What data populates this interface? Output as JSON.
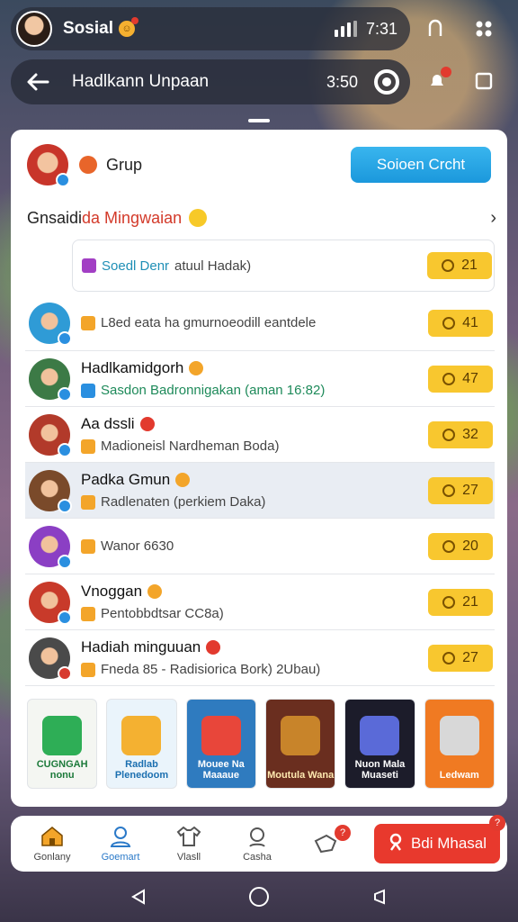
{
  "status_bar": {
    "title": "Sosial",
    "time": "7:31"
  },
  "header": {
    "title": "Hadlkann Unpaan",
    "count": "3:50"
  },
  "group": {
    "label": "Grup",
    "join_button": "Soioen Crcht"
  },
  "section": {
    "title_prefix": "Gnsaidi",
    "title_accent": "da Mingwaian"
  },
  "items": [
    {
      "name": "Soedl Denr",
      "sub": "atuul Hadak)",
      "pill": "21",
      "avatar_color": "#7b3fb8",
      "style": "boxed"
    },
    {
      "name": "",
      "sub": "L8ed eata ha gmurnoeodill eantdele",
      "pill": "41",
      "avatar_color": "#2f9bd6",
      "style": "normal"
    },
    {
      "name": "Hadlkamidgorh",
      "sub": "Sasdon Badronnigakan (aman 16:82)",
      "pill": "47",
      "avatar_color": "#3c7a46",
      "style": "normal",
      "sub_style": "green"
    },
    {
      "name": "Aa dssli",
      "sub": "Madioneisl Nardheman Boda)",
      "pill": "32",
      "avatar_color": "#b23a2a",
      "style": "normal"
    },
    {
      "name": "Padka Gmun",
      "sub": "Radlenaten (perkiem Daka)",
      "pill": "27",
      "avatar_color": "#7a4a2a",
      "style": "highlight"
    },
    {
      "name": "",
      "sub": "Wanor 6630",
      "pill": "20",
      "avatar_color": "#8b3fc4",
      "style": "normal"
    },
    {
      "name": "Vnoggan",
      "sub": "Pentobbdtsar CC8a)",
      "pill": "21",
      "avatar_color": "#c83a2a",
      "style": "normal"
    },
    {
      "name": "Hadiah minguuan",
      "sub": "Fneda 85 - Radisiorica Bork)  2Ubau)",
      "pill": "27",
      "avatar_color": "#4a4a4a",
      "style": "normal"
    }
  ],
  "tiles": [
    {
      "label": "CUGNGAH nonu",
      "bg": "#f4f6f2",
      "fg": "#1c7a3a",
      "art": "#2eae56"
    },
    {
      "label": "Radlab Plenedoom",
      "bg": "#eaf4fb",
      "fg": "#1b6fb0",
      "art": "#f4b131"
    },
    {
      "label": "Mouee Na Maaaue",
      "bg": "#2f7bbf",
      "fg": "#ffffff",
      "art": "#e8463a"
    },
    {
      "label": "Moutula Wana",
      "bg": "#6a2e1f",
      "fg": "#ffe9b0",
      "art": "#c8842a"
    },
    {
      "label": "Nuon Mala Muaseti",
      "bg": "#1c1c2a",
      "fg": "#ffffff",
      "art": "#5a6ad8"
    },
    {
      "label": "Ledwam",
      "bg": "#f07a22",
      "fg": "#ffffff",
      "art": "#d8d8d8"
    }
  ],
  "nav": {
    "items": [
      {
        "label": "Gonlany",
        "icon": "home-icon"
      },
      {
        "label": "Goemart",
        "icon": "user-icon"
      },
      {
        "label": "Vlasll",
        "icon": "shirt-icon"
      },
      {
        "label": "Casha",
        "icon": "search-icon"
      },
      {
        "label": "",
        "icon": "chat-icon",
        "badge": "?"
      }
    ],
    "cta_label": "Bdi Mhasal",
    "cta_badge": "?"
  },
  "colors": {
    "accent": "#1b98dc",
    "pill": "#f8c72f",
    "cta": "#e8392d"
  }
}
